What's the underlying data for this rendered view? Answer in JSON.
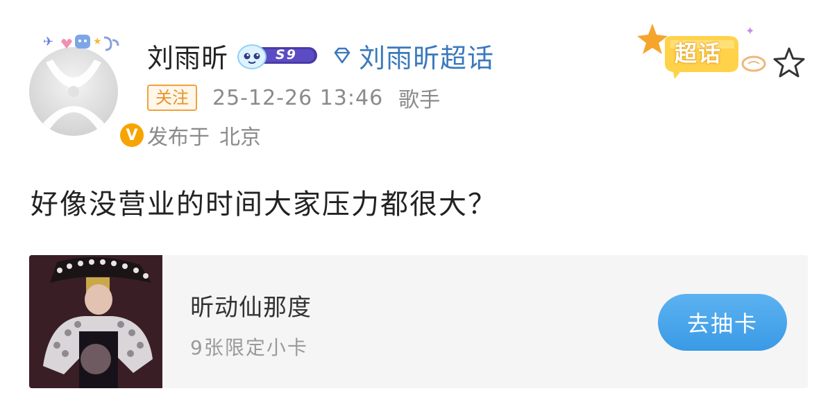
{
  "user": {
    "name": "刘雨昕",
    "level": "S9",
    "verified_mark": "V"
  },
  "supertopic": {
    "label": "刘雨昕超话",
    "sticker": "超话"
  },
  "meta": {
    "follow": "关注",
    "time": "25-12-26 13:46",
    "role": "歌手",
    "location_prefix": "发布于",
    "location": "北京"
  },
  "post": {
    "text": "好像没营业的时间大家压力都很大？"
  },
  "card": {
    "title": "昕动仙那度",
    "subtitle": "9张限定小卡",
    "button": "去抽卡"
  },
  "colors": {
    "link_blue": "#3a79bd",
    "button_blue": "#3a9ae6",
    "follow_orange": "#e8912a",
    "verified_gold": "#f7a400",
    "level_purple": "#4a3aa8"
  },
  "icons": {
    "supertopic": "diamond-icon",
    "favorite": "star-icon",
    "verified": "verified-v-icon"
  }
}
